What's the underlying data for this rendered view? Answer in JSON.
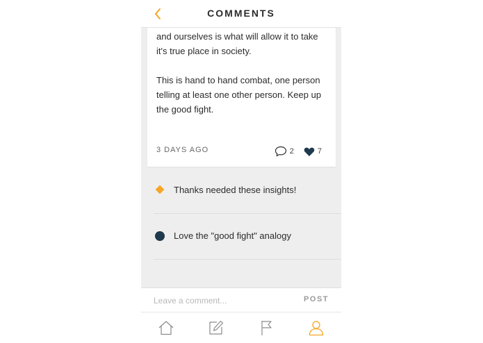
{
  "colors": {
    "accent": "#F5A623",
    "dark_navy": "#1E3A4C",
    "background_gray": "#EEEEEE"
  },
  "header": {
    "title": "COMMENTS",
    "back_icon": "chevron-left-icon"
  },
  "post": {
    "paragraph_1": "and ourselves is what will allow it to take it's true place in society.",
    "paragraph_2": "This is hand to hand combat, one person telling at least one other person.  Keep up the good fight.",
    "timestamp": "3 DAYS AGO",
    "comment_count": "2",
    "like_count": "7",
    "comment_icon": "speech-bubble-icon",
    "like_icon": "heart-icon"
  },
  "comments": [
    {
      "text": "Thanks needed these insights!",
      "marker": "diamond",
      "marker_color": "#F5A623"
    },
    {
      "text": "Love the \"good fight\" analogy",
      "marker": "circle",
      "marker_color": "#1E3A4C"
    }
  ],
  "composer": {
    "placeholder": "Leave a comment...",
    "post_label": "POST"
  },
  "tabbar": {
    "items": [
      {
        "name": "home",
        "icon": "home-icon"
      },
      {
        "name": "compose",
        "icon": "pencil-square-icon"
      },
      {
        "name": "flag",
        "icon": "flag-icon"
      },
      {
        "name": "profile",
        "icon": "user-icon",
        "active": true
      }
    ]
  }
}
